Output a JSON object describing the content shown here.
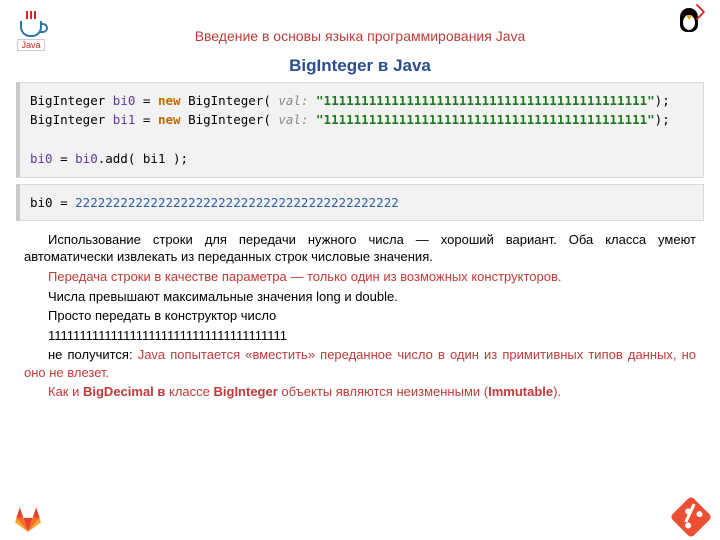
{
  "header": {
    "course_title": "Введение в основы языка программирования Java",
    "page_title": "BigInteger в Java",
    "java_label": "Java"
  },
  "code1": {
    "l1_type": "BigInteger ",
    "l1_var": "bi0",
    "l1_eq": " = ",
    "l1_new": "new ",
    "l1_class": "BigInteger( ",
    "l1_hint": "val: ",
    "l1_str": "\"1111111111111111111111111111111111111111111\"",
    "l1_end": ");",
    "l2_type": "BigInteger ",
    "l2_var": "bi1",
    "l2_eq": " = ",
    "l2_new": "new ",
    "l2_class": "BigInteger( ",
    "l2_hint": "val: ",
    "l2_str": "\"1111111111111111111111111111111111111111111\"",
    "l2_end": ");",
    "blank": " ",
    "l3_a": "bi0",
    "l3_b": " = ",
    "l3_c": "bi0",
    "l3_d": ".add( bi1 );"
  },
  "code2": {
    "a": "bi0 = ",
    "b": "2222222222222222222222222222222222222222222"
  },
  "para": {
    "p1": "Использование строки для передачи нужного числа — хороший вариант. Оба класса умеют автоматически извлекать из переданных строк числовые значения.",
    "p2": "Передача строки в качестве параметра — только один из возможных конструкторов.",
    "p3": "Числа превышают максимальные значения long и double.",
    "p4": "Просто передать в конструктор число",
    "p5": "11111111111111111111111111111111111111",
    "p6a": "не получится: ",
    "p6b": "Java попытается «вместить» переданное число в один из примитивных типов данных, но оно не влезет.",
    "p7a": "Как и ",
    "p7b": "BigDecimal в",
    "p7c": " классе ",
    "p7d": "BigInteger",
    "p7e": " объекты являются неизменными (",
    "p7f": "Immutable",
    "p7g": ")."
  }
}
